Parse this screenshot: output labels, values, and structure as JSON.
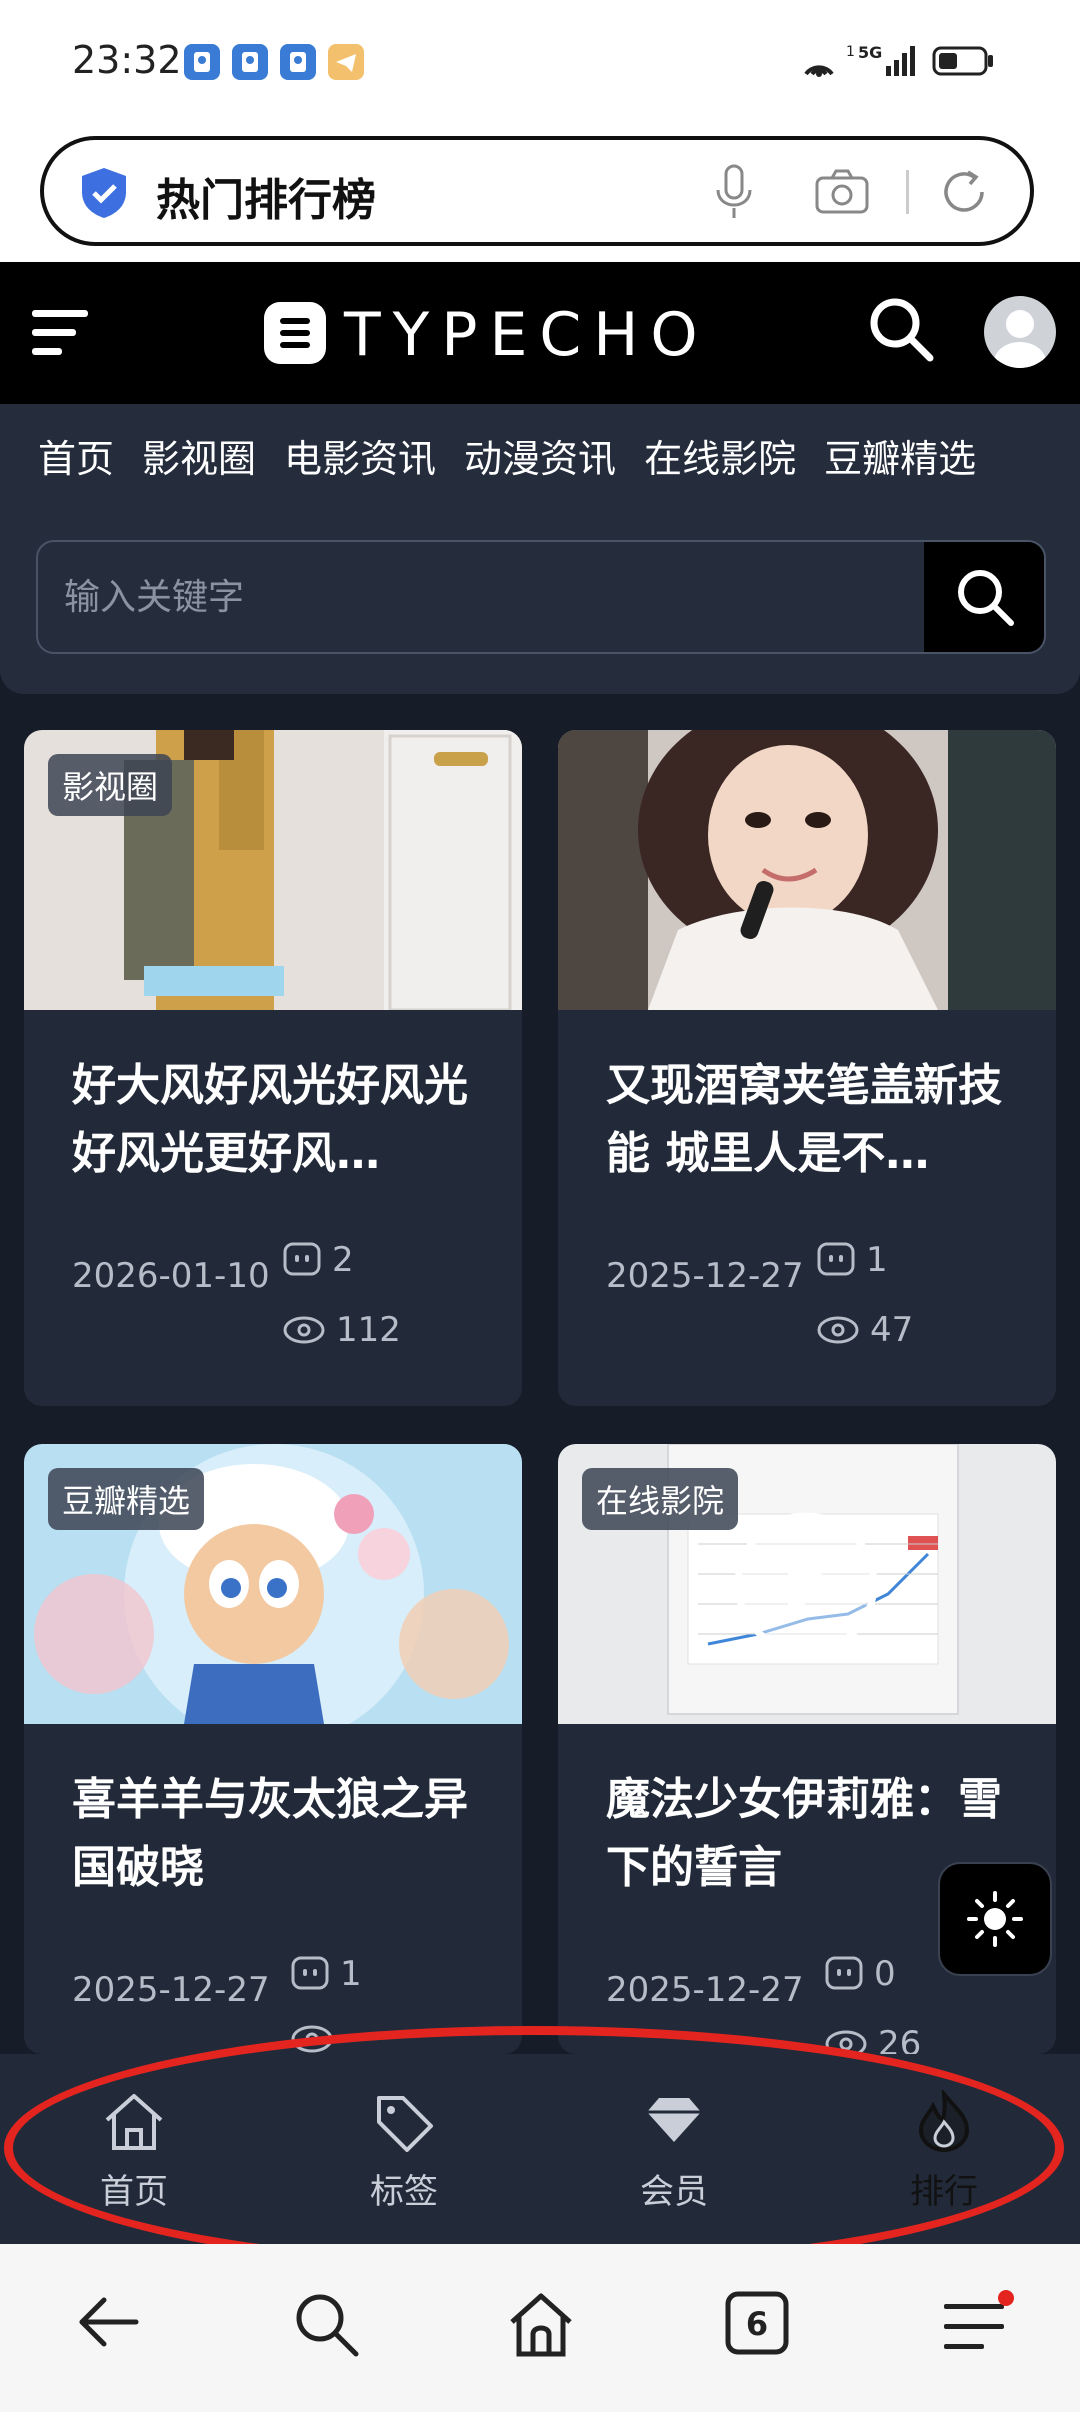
{
  "status_bar": {
    "time": "23:32",
    "network": "5G",
    "network_sub": "1"
  },
  "browser": {
    "url_text": "热门排行榜",
    "tabs_count": "6"
  },
  "site": {
    "logo_text": "TYPECHO",
    "nav_links": [
      "首页",
      "影视圈",
      "电影资讯",
      "动漫资讯",
      "在线影院",
      "豆瓣精选"
    ],
    "search_placeholder": "输入关键字"
  },
  "posts": [
    {
      "category": "影视圈",
      "title": "好大风好风光好风光好风光更好风…",
      "date": "2026-01-10",
      "comments": "2",
      "views": "112"
    },
    {
      "category": "",
      "title": "又现酒窝夹笔盖新技能 城里人是不…",
      "date": "2025-12-27",
      "comments": "1",
      "views": "47"
    },
    {
      "category": "豆瓣精选",
      "title": "喜羊羊与灰太狼之异国破晓",
      "date": "2025-12-27",
      "comments": "1",
      "views": ""
    },
    {
      "category": "在线影院",
      "title": "魔法少女伊莉雅：雪下的誓言",
      "date": "2025-12-27",
      "comments": "0",
      "views": "26"
    }
  ],
  "site_bottom_nav": [
    {
      "label": "首页",
      "icon": "home-icon"
    },
    {
      "label": "标签",
      "icon": "tag-icon"
    },
    {
      "label": "会员",
      "icon": "diamond-icon"
    },
    {
      "label": "排行",
      "icon": "fire-icon"
    }
  ],
  "colors": {
    "page_bg": "#171c29",
    "card_bg": "#222a39",
    "header_bg": "#000000",
    "annotation": "#e4251f"
  }
}
